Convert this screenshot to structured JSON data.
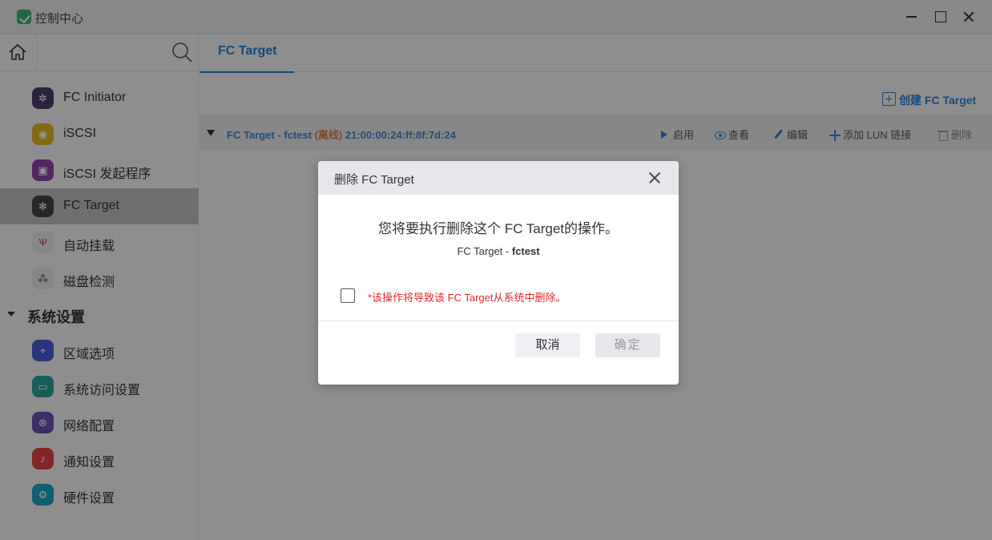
{
  "window": {
    "title": "控制中心"
  },
  "sidebar": {
    "items": [
      {
        "label": "FC Initiator",
        "icon": "fc-initiator-icon",
        "color": "#4b3d6b"
      },
      {
        "label": "iSCSI",
        "icon": "iscsi-icon",
        "color": "#e6b422"
      },
      {
        "label": "iSCSI 发起程序",
        "icon": "iscsi-initiator-icon",
        "color": "#8e44ad"
      },
      {
        "label": "FC Target",
        "icon": "fc-target-icon",
        "color": "#444444",
        "active": true
      },
      {
        "label": "自动挂载",
        "icon": "auto-mount-icon",
        "color": "#e9e9e9"
      },
      {
        "label": "磁盘检测",
        "icon": "disk-check-icon",
        "color": "#e9e9e9"
      }
    ],
    "section": {
      "label": "系统设置"
    },
    "section_items": [
      {
        "label": "区域选项",
        "icon": "region-icon",
        "color": "#4a5ad8"
      },
      {
        "label": "系统访问设置",
        "icon": "system-access-icon",
        "color": "#2aa198"
      },
      {
        "label": "网络配置",
        "icon": "network-icon",
        "color": "#6a4fb5"
      },
      {
        "label": "通知设置",
        "icon": "notification-icon",
        "color": "#e04444"
      },
      {
        "label": "硬件设置",
        "icon": "hardware-icon",
        "color": "#1ba3c4"
      }
    ]
  },
  "main": {
    "tab": "FC Target",
    "create_label": "创建 FC Target",
    "row": {
      "name": "FC Target - fctest",
      "status": "(离线)",
      "wwn": "21:00:00:24:ff:8f:7d:24",
      "actions": {
        "start": "启用",
        "view": "查看",
        "edit": "编辑",
        "add_lun": "添加 LUN 链接",
        "delete": "删除"
      }
    }
  },
  "dialog": {
    "title": "删除 FC Target",
    "message": "您将要执行删除这个 FC Target的操作。",
    "sub_prefix": "FC Target - ",
    "sub_name": "fctest",
    "warning": "*该操作将导致该 FC Target从系统中删除。",
    "cancel_label": "取消",
    "confirm_label": "确定"
  },
  "colors": {
    "accent": "#2a7fd4",
    "warning": "#d92b2b",
    "offline": "#e07a3a"
  }
}
